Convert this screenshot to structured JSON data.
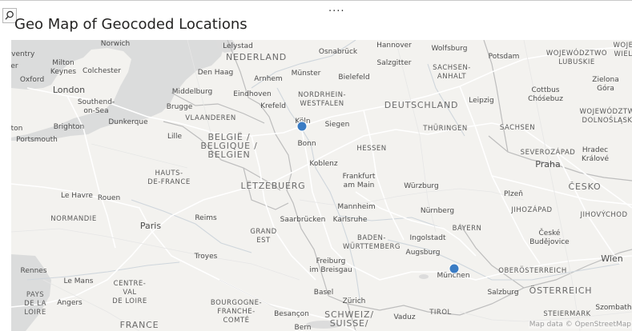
{
  "visual": {
    "title": "Geo Map of Geocoded Locations",
    "more_options": "....",
    "search_icon": "search-icon"
  },
  "map": {
    "attribution": "Map data © OpenStreetMap",
    "point_color": "#3a7cc4",
    "points": [
      {
        "name": "Köln"
      },
      {
        "name": "München"
      }
    ],
    "labels": {
      "norwich": "Norwich",
      "lelystad": "Lelystad",
      "hannover": "Hannover",
      "wolfsburg": "Wolfsburg",
      "potsdam": "Potsdam",
      "wojewodztwo_lubuskie": "WOJEWÓDZTWO\nLUBUSKIE",
      "woje_wiel": "WOJE\nWIEL",
      "coventry": "oventry",
      "milton_keynes": "Milton\nKeynes",
      "colchester": "Colchester",
      "nederland": "NEDERLAND",
      "osnabruck": "Osnabrück",
      "salzgitter": "Salzgitter",
      "oxford": "Oxford",
      "er": "er",
      "den_haag": "Den Haag",
      "arnhem": "Arnhem",
      "munster": "Münster",
      "bielefeld": "Bielefeld",
      "sachsen_anhalt": "SACHSEN-\nANHALT",
      "zielona_gora": "Zielona\nGóra",
      "london": "London",
      "middelburg": "Middelburg",
      "eindhoven": "Eindhoven",
      "nordrhein_westfalen": "NORDRHEIN-\nWESTFALEN",
      "cottbus": "Cottbus\nChóśebuz",
      "southend": "Southend-\non-Sea",
      "brugge": "Brugge",
      "krefeld": "Krefeld",
      "deutschland": "DEUTSCHLAND",
      "leipzig": "Leipzig",
      "wojewodztwo_dolnoslaskie": "WOJEWÓDZTW\nDOLNOŚLĄSK",
      "dunkerque": "Dunkerque",
      "vlaanderen": "VLAANDEREN",
      "koln": "Köln",
      "siegen": "Siegen",
      "brighton": "Brighton",
      "ton": "ton",
      "thuringen": "THÜRINGEN",
      "sachsen": "SACHSEN",
      "portsmouth": "Portsmouth",
      "lille": "Lille",
      "belgie": "BELGIË /\nBELGIQUE /\nBELGIEN",
      "bonn": "Bonn",
      "hessen": "HESSEN",
      "severozapad": "SEVEROZÁPAD",
      "hradec": "Hradec\nKrálové",
      "koblenz": "Koblenz",
      "praha": "Praha",
      "hauts_de_france": "HAUTS-\nDE-FRANCE",
      "frankfurt": "Frankfurt\nam Main",
      "letzebuerg": "LËTZEBUERG",
      "wurzburg": "Würzburg",
      "cesko": "ČESKO",
      "le_havre": "Le Havre",
      "rouen": "Rouen",
      "plzen": "Plzeň",
      "mannheim": "Mannheim",
      "nurnberg": "Nürnberg",
      "jihozapad": "JIHOZÁPAD",
      "jihovychod": "JIHOVÝCHOD",
      "normandie": "NORMANDIE",
      "reims": "Reims",
      "saarbrucken": "Saarbrücken",
      "karlsruhe": "Karlsruhe",
      "paris": "Paris",
      "bayern": "BAYERN",
      "grand_est": "GRAND\nEST",
      "baden_wurttemberg": "BADEN-\nWÜRTTEMBERG",
      "ingolstadt": "Ingolstadt",
      "ceske_budejovice": "České\nBudějovice",
      "augsburg": "Augsburg",
      "troyes": "Troyes",
      "wien": "Wien",
      "freiburg": "Freiburg\nim Breisgau",
      "oberosterreich": "OBERÖSTERREICH",
      "rennes": "Rennes",
      "munchen": "München",
      "le_mans": "Le Mans",
      "centre_val_de_loire": "CENTRE-\nVAL\nDE LOIRE",
      "osterreich": "ÖSTERREICH",
      "basel": "Basel",
      "pays_de_la_loire": "PAYS\nDE LA\nLOIRE",
      "angers": "Angers",
      "salzburg": "Salzburg",
      "zurich": "Zürich",
      "bourgogne": "BOURGOGNE-\nFRANCHE-\nCOMTÉ",
      "besancon": "Besançon",
      "schweiz": "SCHWEIZ/\nSUISSE/",
      "vaduz": "Vaduz",
      "tirol": "TIROL",
      "steiermark": "STEIERMARK",
      "szombath": "Szombath",
      "france": "FRANCE",
      "bern": "Bern"
    }
  }
}
